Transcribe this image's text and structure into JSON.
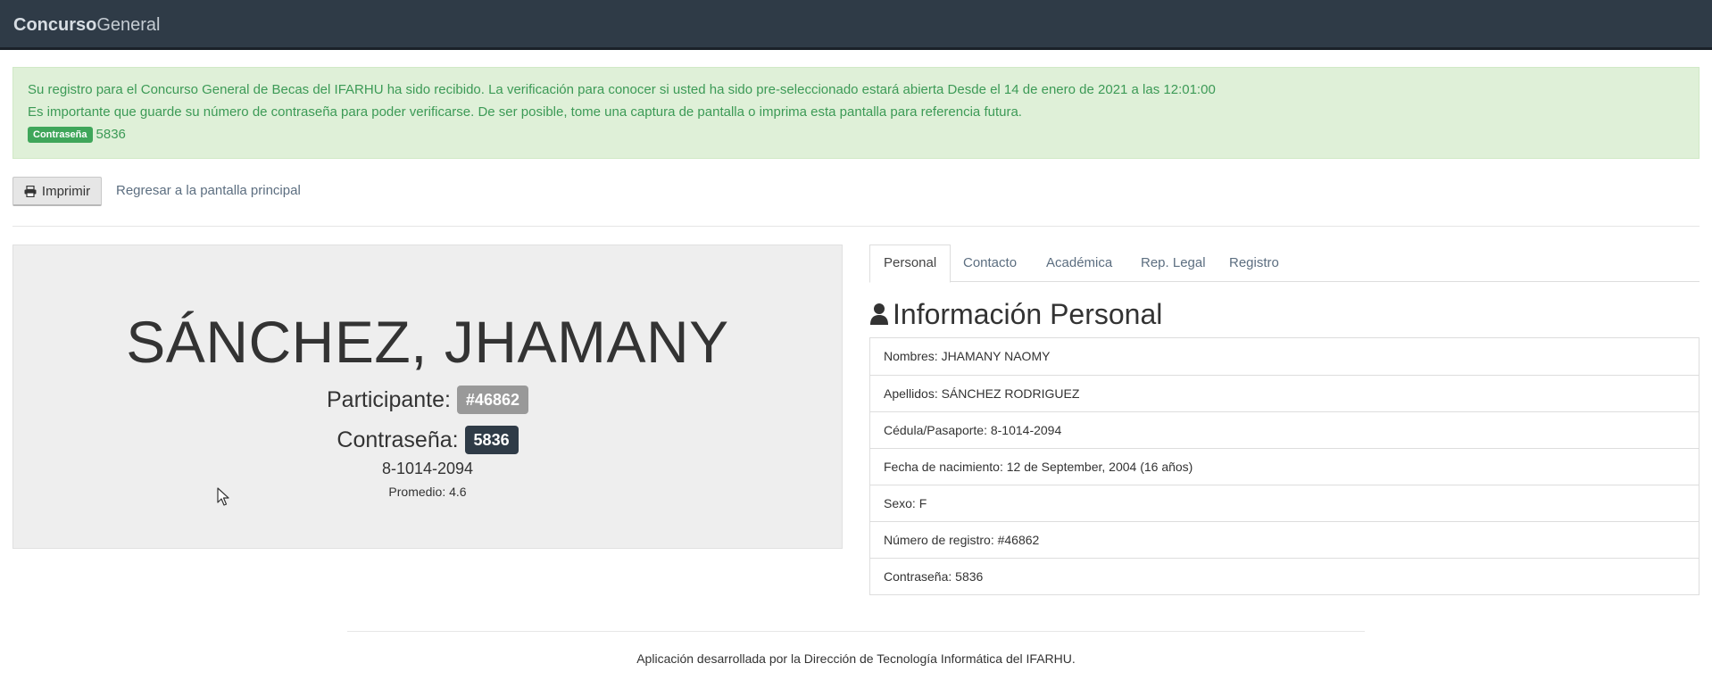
{
  "navbar": {
    "brand_bold": "Concurso",
    "brand_light": "General"
  },
  "alert": {
    "line1": "Su registro para el Concurso General de Becas del IFARHU ha sido recibido. La verificación para conocer si usted ha sido pre-seleccionado estará abierta Desde el 14 de enero de 2021 a las 12:01:00",
    "line2": "Es importante que guarde su número de contraseña para poder verificarse. De ser posible, tome una captura de pantalla o imprima esta pantalla para referencia futura.",
    "password_label": "Contraseña",
    "password_value": "5836"
  },
  "toolbar": {
    "print_label": "Imprimir",
    "back_link": "Regresar a la pantalla principal"
  },
  "card": {
    "name": "SÁNCHEZ, JHAMANY",
    "participant_label": "Participante:",
    "participant_number": "#46862",
    "password_label": "Contraseña:",
    "password_value": "5836",
    "cedula": "8-1014-2094",
    "promedio": "Promedio: 4.6"
  },
  "tabs": [
    {
      "label": "Personal",
      "active": true
    },
    {
      "label": "Contacto",
      "active": false
    },
    {
      "label": "Académica",
      "active": false
    },
    {
      "label": "Rep. Legal",
      "active": false
    },
    {
      "label": "Registro",
      "active": false
    }
  ],
  "section": {
    "title": "Información Personal",
    "items": [
      "Nombres: JHAMANY NAOMY",
      "Apellidos: SÁNCHEZ RODRIGUEZ",
      "Cédula/Pasaporte: 8-1014-2094",
      "Fecha de nacimiento: 12 de September, 2004 (16 años)",
      "Sexo: F",
      "Número de registro: #46862",
      "Contraseña: 5836"
    ]
  },
  "footer": {
    "text": "Aplicación desarrollada por la Dirección de Tecnología Informática del IFARHU."
  },
  "colors": {
    "navbar_bg": "#2f3b47",
    "alert_bg": "#dff0d8",
    "alert_text": "#3c9a56",
    "label_green": "#3fa65a",
    "badge_gray": "#999999",
    "badge_dark": "#2f3b47",
    "link": "#5c6e80",
    "card_bg": "#eeeeee"
  },
  "icons": {
    "print": "printer-icon",
    "section": "user-icon"
  }
}
